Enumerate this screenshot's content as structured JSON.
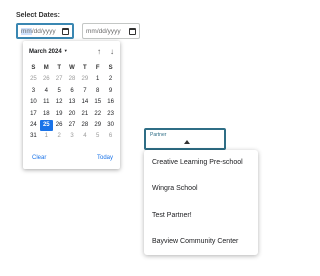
{
  "form": {
    "label": "Select Dates:",
    "start_date": {
      "placeholder_mm": "mm",
      "placeholder_rest": "/dd/yyyy"
    },
    "end_date": {
      "placeholder": "mm/dd/yyyy"
    }
  },
  "calendar": {
    "month_label": "March 2024",
    "month_caret": "▼",
    "nav_up": "↑",
    "nav_down": "↓",
    "weekdays": [
      "S",
      "M",
      "T",
      "W",
      "T",
      "F",
      "S"
    ],
    "weeks": [
      [
        {
          "d": "25",
          "o": true
        },
        {
          "d": "26",
          "o": true
        },
        {
          "d": "27",
          "o": true
        },
        {
          "d": "28",
          "o": true
        },
        {
          "d": "29",
          "o": true
        },
        {
          "d": "1"
        },
        {
          "d": "2"
        }
      ],
      [
        {
          "d": "3"
        },
        {
          "d": "4"
        },
        {
          "d": "5"
        },
        {
          "d": "6"
        },
        {
          "d": "7"
        },
        {
          "d": "8"
        },
        {
          "d": "9"
        }
      ],
      [
        {
          "d": "10"
        },
        {
          "d": "11"
        },
        {
          "d": "12"
        },
        {
          "d": "13"
        },
        {
          "d": "14"
        },
        {
          "d": "15"
        },
        {
          "d": "16"
        }
      ],
      [
        {
          "d": "17"
        },
        {
          "d": "18"
        },
        {
          "d": "19"
        },
        {
          "d": "20"
        },
        {
          "d": "21"
        },
        {
          "d": "22"
        },
        {
          "d": "23"
        }
      ],
      [
        {
          "d": "24"
        },
        {
          "d": "25",
          "s": true
        },
        {
          "d": "26"
        },
        {
          "d": "27"
        },
        {
          "d": "28"
        },
        {
          "d": "29"
        },
        {
          "d": "30"
        }
      ],
      [
        {
          "d": "31"
        },
        {
          "d": "1",
          "o": true
        },
        {
          "d": "2",
          "o": true
        },
        {
          "d": "3",
          "o": true
        },
        {
          "d": "4",
          "o": true
        },
        {
          "d": "5",
          "o": true
        },
        {
          "d": "6",
          "o": true
        }
      ]
    ],
    "clear_label": "Clear",
    "today_label": "Today",
    "selected_color": "#1a73e8"
  },
  "partner": {
    "label": "Partner",
    "options": [
      "Creative Learning Pre-school",
      "Wingra School",
      "Test Partner!",
      "Bayview Community Center"
    ]
  }
}
